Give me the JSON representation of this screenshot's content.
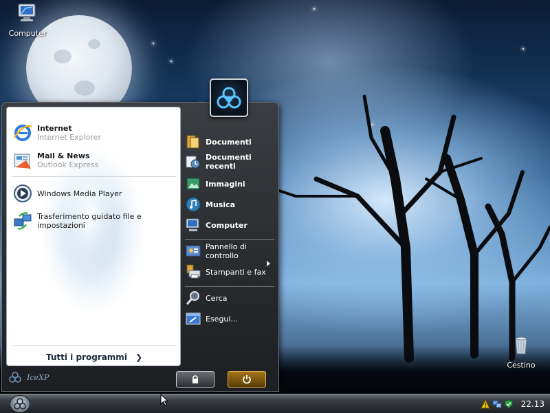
{
  "desktop": {
    "icons": {
      "computer": "Computer",
      "trash": "Cestino"
    }
  },
  "start_menu": {
    "pinned": [
      {
        "title": "Internet",
        "subtitle": "Internet Explorer",
        "icon": "internet-explorer-icon"
      },
      {
        "title": "Mail & News",
        "subtitle": "Outlook Express",
        "icon": "outlook-express-icon"
      }
    ],
    "recent": [
      {
        "label": "Windows Media Player",
        "icon": "media-player-icon"
      },
      {
        "label": "Trasferimento guidato file e impostazioni",
        "icon": "file-transfer-wizard-icon"
      }
    ],
    "all_programs": "Tutti i programmi",
    "places": {
      "documents": "Documenti",
      "recent_documents": "Documenti recenti",
      "pictures": "Immagini",
      "music": "Musica",
      "computer": "Computer"
    },
    "system": {
      "control_panel": "Pannello di controllo",
      "printers": "Stampanti e fax",
      "search": "Cerca",
      "run": "Esegui..."
    },
    "brand": "IceXP"
  },
  "taskbar": {
    "clock": "22.13"
  },
  "colors": {
    "menu_dark": "#1c1e21",
    "accent_power": "#a27417",
    "text_muted": "#9a9a9a"
  }
}
